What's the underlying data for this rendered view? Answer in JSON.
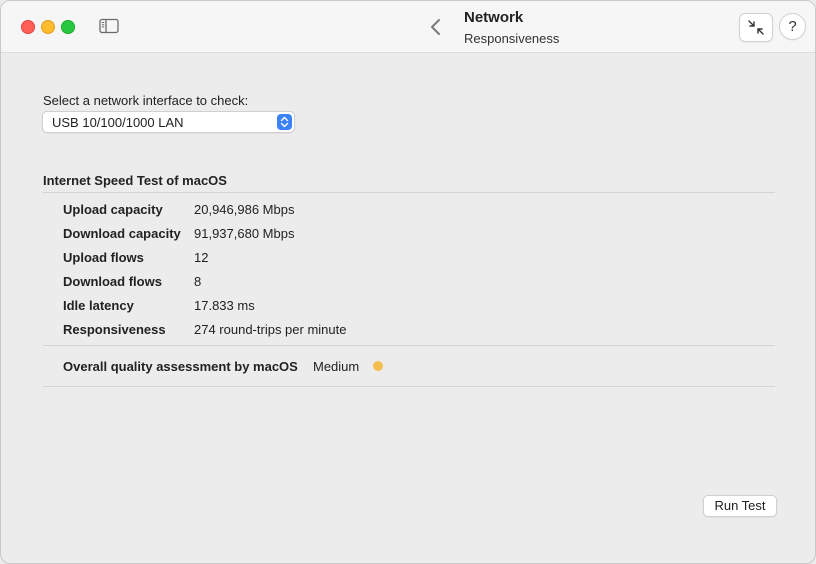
{
  "window": {
    "title": "Network",
    "subtitle": "Responsiveness",
    "help_label": "?"
  },
  "interface_select": {
    "label": "Select a network interface to check:",
    "selected": "USB 10/100/1000 LAN"
  },
  "speed_test": {
    "title": "Internet Speed Test of macOS",
    "rows": [
      {
        "label": "Upload capacity",
        "value": "20,946,986 Mbps"
      },
      {
        "label": "Download capacity",
        "value": "91,937,680 Mbps"
      },
      {
        "label": "Upload flows",
        "value": "12"
      },
      {
        "label": "Download flows",
        "value": "8"
      },
      {
        "label": "Idle latency",
        "value": "17.833 ms"
      },
      {
        "label": "Responsiveness",
        "value": "274 round-trips per minute"
      }
    ],
    "overall_label": "Overall quality assessment by macOS",
    "overall_value": "Medium",
    "overall_color": "#f5bf4f"
  },
  "actions": {
    "run_test": "Run Test"
  }
}
